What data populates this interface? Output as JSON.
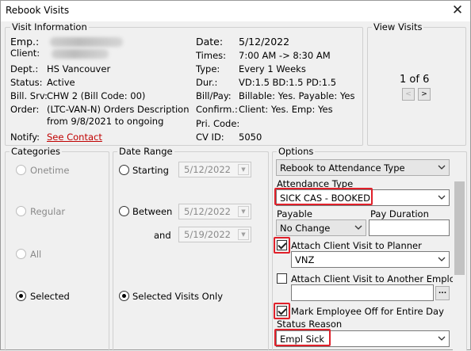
{
  "window": {
    "title": "Rebook Visits",
    "close_glyph": "✕"
  },
  "visit_info": {
    "legend": "Visit Information",
    "emp_label": "Emp.:",
    "client_label": "Client:",
    "dept_label": "Dept.:",
    "dept_value": "HS Vancouver",
    "status_label": "Status:",
    "status_value": "Active",
    "bill_label": "Bill. Srv:",
    "bill_value": "CHW 2 (Bill Code: 00)",
    "order_label": "Order:",
    "order_value_1": "(LTC-VAN-N) Orders Description",
    "order_value_2": "from 9/8/2021 to ongoing",
    "notify_label": "Notify:",
    "notify_link": "See Contact",
    "date_label": "Date:",
    "date_value": "5/12/2022",
    "times_label": "Times:",
    "times_value": "7:00 AM -> 8:30 AM",
    "type_label": "Type:",
    "type_value": "Every 1 Weeks",
    "dur_label": "Dur.:",
    "dur_value": "VD:1.5  BD:1.5  PD:1.5",
    "billpay_label": "Bill/Pay:",
    "billpay_value": "Billable: Yes. Payable: Yes",
    "confirm_label": "Confirm.:",
    "confirm_value": "Client: Yes. Emp: Yes",
    "pricode_label": "Pri. Code:",
    "cvid_label": "CV ID:",
    "cvid_value": "5050"
  },
  "view_visits": {
    "legend": "View Visits",
    "counter": "1 of 6",
    "prev": "<",
    "next": ">"
  },
  "categories": {
    "legend": "Categories",
    "items": [
      {
        "label": "Onetime",
        "selected": false,
        "enabled": false
      },
      {
        "label": "Regular",
        "selected": false,
        "enabled": false
      },
      {
        "label": "All",
        "selected": false,
        "enabled": false
      },
      {
        "label": "Selected",
        "selected": true,
        "enabled": true
      }
    ]
  },
  "date_range": {
    "legend": "Date Range",
    "starting_label": "Starting",
    "starting_value": "5/12/2022",
    "between_label": "Between",
    "between_value": "5/12/2022",
    "and_label": "and",
    "and_value": "5/19/2022",
    "selected_only_label": "Selected Visits Only"
  },
  "options": {
    "legend": "Options",
    "mode_value": "Rebook to Attendance Type",
    "attendance_type_label": "Attendance Type",
    "attendance_type_value": "SICK CAS - BOOKED",
    "payable_label": "Payable",
    "payable_value": "No Change",
    "pay_duration_label": "Pay Duration",
    "pay_duration_value": "",
    "attach_planner_label": "Attach Client Visit to Planner",
    "attach_planner_checked": true,
    "planner_value": "VNZ",
    "attach_other_label": "Attach Client Visit to Another Emplo",
    "attach_other_checked": false,
    "other_emp_value": "",
    "ellipsis": "...",
    "mark_off_label": "Mark Employee Off for Entire Day",
    "mark_off_checked": true,
    "status_reason_label": "Status Reason",
    "status_reason_value": "Empl Sick"
  },
  "colors": {
    "highlight": "#e0202a",
    "link": "#c00000"
  }
}
